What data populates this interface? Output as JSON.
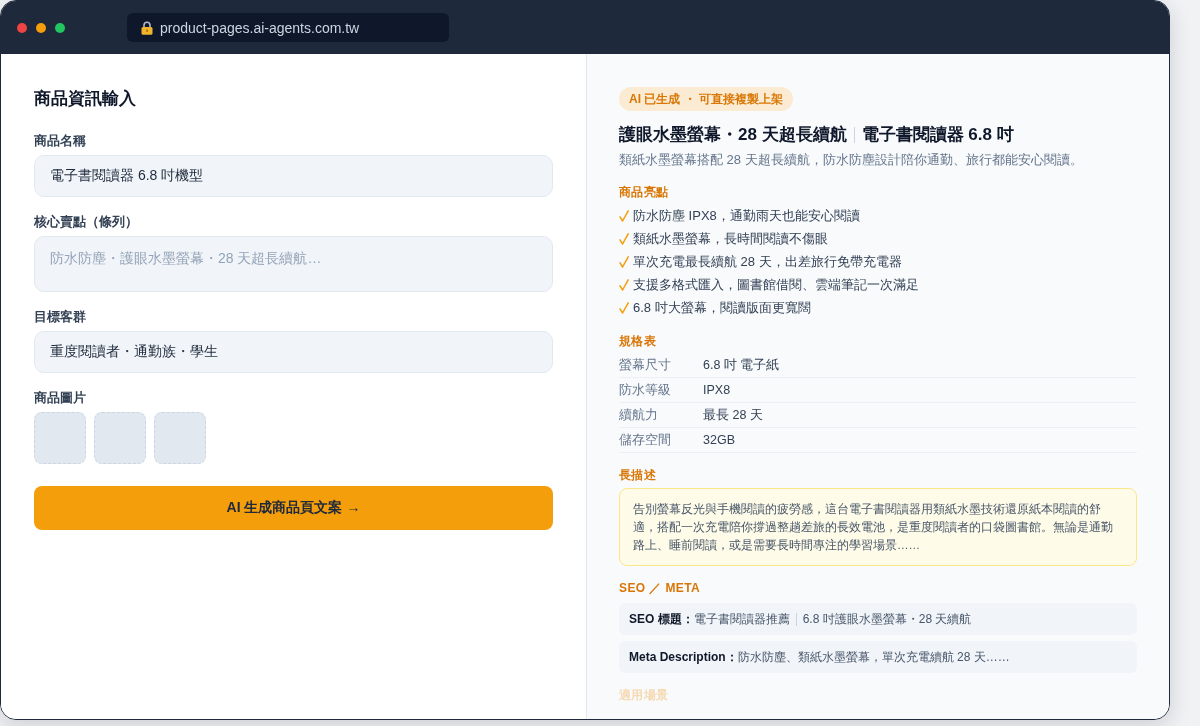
{
  "window": {
    "url": "product-pages.ai-agents.com.tw"
  },
  "form": {
    "title": "商品資訊輸入",
    "fields": [
      {
        "kind": "input",
        "label": "商品名稱",
        "value": "電子書閱讀器 6.8 吋機型"
      },
      {
        "kind": "textarea",
        "label": "核心賣點（條列）",
        "placeholder": "防水防塵・護眼水墨螢幕・28 天超長續航…"
      },
      {
        "kind": "input",
        "label": "目標客群",
        "value": "重度閱讀者・通勤族・學生"
      },
      {
        "kind": "images",
        "label": "商品圖片",
        "slots": [
          {
            "kind": "empty"
          },
          {
            "kind": "empty"
          },
          {
            "kind": "empty"
          }
        ]
      }
    ],
    "button": "AI 生成商品頁文案 →"
  },
  "output": {
    "badge": "AI 已生成 ・ 可直接複製上架",
    "headline": [
      "護眼水墨螢幕・28 天超長續航",
      "電子書閱讀器 6.8 吋"
    ],
    "subtitle": "類紙水墨螢幕搭配 28 天超長續航，防水防塵設計陪你通勤、旅行都能安心閱讀。",
    "sections": [
      {
        "kind": "bullets",
        "title": "商品亮點",
        "items": [
          "防水防塵 IPX8，通勤雨天也能安心閱讀",
          "類紙水墨螢幕，長時間閱讀不傷眼",
          "單次充電最長續航 28 天，出差旅行免帶充電器",
          "支援多格式匯入，圖書館借閱、雲端筆記一次滿足",
          "6.8 吋大螢幕，閱讀版面更寬闊"
        ]
      },
      {
        "kind": "specs",
        "title": "規格表",
        "rows": [
          {
            "key": "螢幕尺寸",
            "value": "6.8 吋 電子紙"
          },
          {
            "key": "防水等級",
            "value": "IPX8"
          },
          {
            "key": "續航力",
            "value": "最長 28 天"
          },
          {
            "key": "儲存空間",
            "value": "32GB"
          }
        ]
      },
      {
        "kind": "text",
        "title": "長描述",
        "text": "告別螢幕反光與手機閱讀的疲勞感，這台電子書閱讀器用類紙水墨技術還原紙本閱讀的舒適，搭配一次充電陪你撐過整趟差旅的長效電池，是重度閱讀者的口袋圖書館。無論是通勤路上、睡前閱讀，或是需要長時間專注的學習場景……"
      },
      {
        "kind": "meta",
        "title": "SEO ／ META",
        "rows": [
          {
            "label": "SEO 標題：",
            "parts": [
              "電子書閱讀器推薦",
              "6.8 吋護眼水墨螢幕・28 天續航"
            ]
          },
          {
            "label": "Meta Description：",
            "parts": [
              "防水防塵、類紙水墨螢幕，單次充電續航 28 天……"
            ]
          }
        ]
      },
      {
        "kind": "faded",
        "title": "適用場景"
      }
    ]
  }
}
